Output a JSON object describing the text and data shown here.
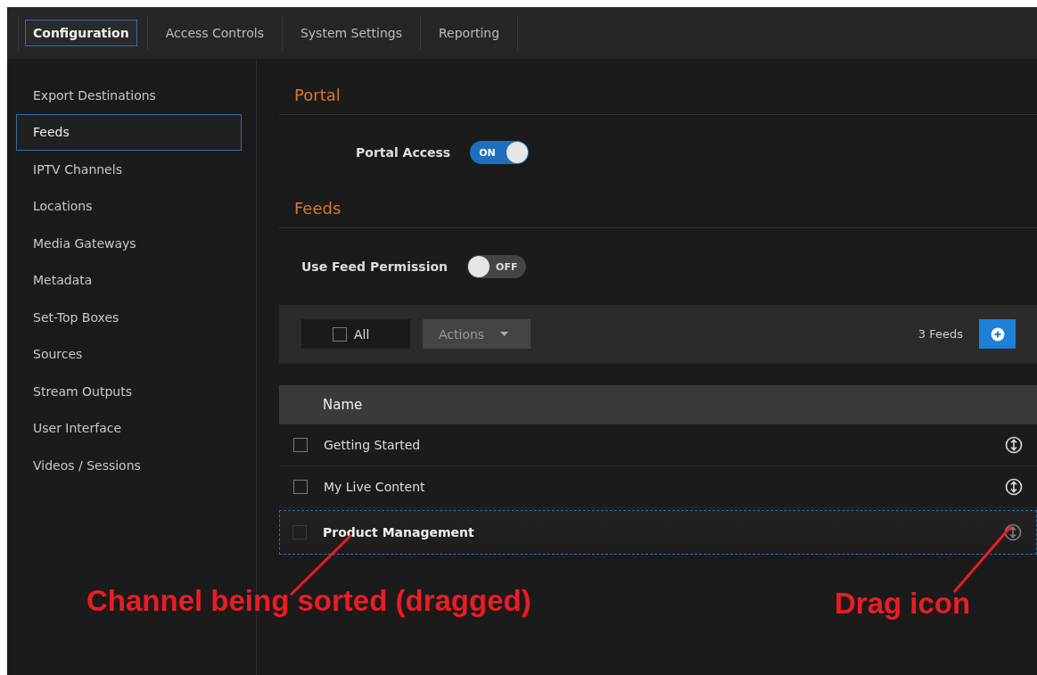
{
  "tabs": [
    {
      "label": "Configuration",
      "selected": true
    },
    {
      "label": "Access Controls",
      "selected": false
    },
    {
      "label": "System Settings",
      "selected": false
    },
    {
      "label": "Reporting",
      "selected": false
    }
  ],
  "sidebar": {
    "items": [
      {
        "label": "Export Destinations",
        "selected": false
      },
      {
        "label": "Feeds",
        "selected": true
      },
      {
        "label": "IPTV Channels",
        "selected": false
      },
      {
        "label": "Locations",
        "selected": false
      },
      {
        "label": "Media Gateways",
        "selected": false
      },
      {
        "label": "Metadata",
        "selected": false
      },
      {
        "label": "Set-Top Boxes",
        "selected": false
      },
      {
        "label": "Sources",
        "selected": false
      },
      {
        "label": "Stream Outputs",
        "selected": false
      },
      {
        "label": "User Interface",
        "selected": false
      },
      {
        "label": "Videos / Sessions",
        "selected": false
      }
    ]
  },
  "portal": {
    "title": "Portal",
    "setting": {
      "label": "Portal Access",
      "on": true,
      "state_text": "ON"
    }
  },
  "feeds": {
    "title": "Feeds",
    "setting": {
      "label": "Use Feed Permission",
      "on": false,
      "state_text": "OFF"
    },
    "toolbar": {
      "select_all": {
        "label": "All",
        "checked": false
      },
      "actions": "Actions",
      "count": "3 Feeds"
    },
    "table": {
      "columns": [
        "Name"
      ],
      "rows": [
        {
          "name": "Getting Started",
          "checked": false,
          "dragging": false
        },
        {
          "name": "My Live Content",
          "checked": false,
          "dragging": false
        },
        {
          "name": "Product Management",
          "checked": false,
          "dragging": true
        }
      ]
    }
  },
  "annotations": [
    {
      "text": "Channel being sorted (dragged)"
    },
    {
      "text": "Drag icon"
    }
  ]
}
